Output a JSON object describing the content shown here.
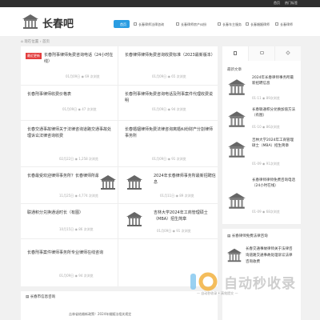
{
  "topbar": {
    "home": "首页",
    "tags": "热门标签"
  },
  "brand": {
    "name": "长春吧"
  },
  "nav": [
    {
      "label": "首页",
      "active": true
    },
    {
      "label": "长春律师法律咨询"
    },
    {
      "label": "长春律师房产纠纷"
    },
    {
      "label": "长春车主服务"
    },
    {
      "label": "长春婚姻律师"
    },
    {
      "label": "长春律师"
    }
  ],
  "breadcrumb": {
    "home": "现在位置",
    "current": "首页"
  },
  "main": {
    "badge": "最近更新",
    "articles": [
      {
        "title": "长春刑事律师免费咨询电话（24小时在线）",
        "meta": "01月09日 ◉ 69 次浏览"
      },
      {
        "title": "长春律师律师免费咨询收费标准（2023最新版本）",
        "meta": "01月09日 ◉ 65 次浏览"
      },
      {
        "title": "长春刑事律师收费价格表",
        "meta": "01月09日 ◉ 47 次浏览"
      },
      {
        "title": "长春刑事律师免费咨询电话及刑事案件代理收费说明",
        "meta": "01月09日 ◉ 94 次浏览"
      },
      {
        "title": "长春交通事故律师关于法律咨询道路交通事故处理诉讼法律咨询收费",
        "meta": "02月22日 ◉ 1,258 次浏览"
      },
      {
        "title": "长春婚姻律师免费法律咨询离婚纠纷财产分割律师事务所",
        "meta": "01月09日 ◉ 91 次浏览"
      },
      {
        "title": "长春最受欢迎律师事务所？长春律师所最好的",
        "meta": "11月25日 ◉ 4,774 次浏览"
      },
      {
        "title": "2024年长春律师事务所最新招聘信息",
        "meta": "01月11日 ◉ 89 次浏览"
      },
      {
        "title": "联通积分兑换通话时长（有图）",
        "meta": "10月15日 ◉ 86 次浏览"
      },
      {
        "title": "吉林大学2024年工商管理硕士（MBA）招生简章",
        "meta": "01月09日 ◉ 91 次浏览"
      },
      {
        "title": "长春刑事案件律师事务所专业律师在线咨询",
        "meta": "01月09日 ◉ 94 次浏览"
      }
    ]
  },
  "sidebar": {
    "section_title": "最新文章",
    "items": [
      {
        "title": "2024年长春律师事务所最新招聘信息",
        "meta": "01-11 ◉ 89次浏览"
      },
      {
        "title": "长春联通积分兑换加值方法（有图）",
        "meta": "01-10 ◉ 86次浏览"
      },
      {
        "title": "吉林大学2024年工商管理硕士（MBA）招生简章",
        "meta": "01-09 ◉ 91次浏览"
      },
      {
        "title": "长春律师律师免费咨询电话（24小时在线）",
        "meta": "01-09 ◉ 68次浏览"
      }
    ]
  },
  "sidebar2": {
    "heading": "长春律师免费法律咨询",
    "body": "长春交通事故律师关于法律咨询道路交通事故处理诉讼法律咨询收费"
  },
  "bottom": {
    "heading": "长春市信息咨询",
    "item": "吉林省结婚新政策！2024年婚姻法相关规定"
  },
  "watermark": {
    "text": "自动秒收录",
    "sub": "— 自动秒收录 • 高效提交 —"
  },
  "colors": {
    "accent": "#2a9de2",
    "badge": "#e33d3d"
  }
}
